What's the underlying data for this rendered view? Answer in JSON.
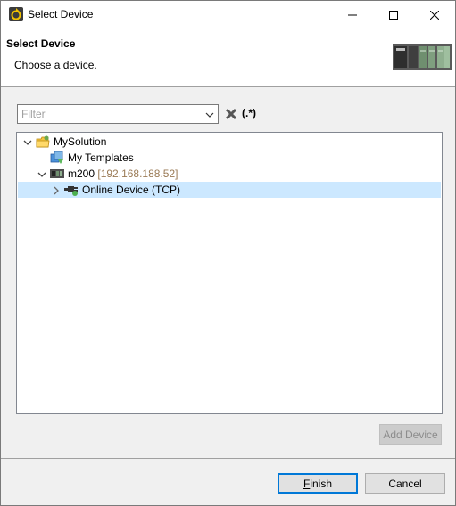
{
  "window": {
    "title": "Select Device"
  },
  "header": {
    "title": "Select Device",
    "description": "Choose a device."
  },
  "filter": {
    "placeholder": "Filter",
    "value": "",
    "regex_label": "(.*)"
  },
  "tree": {
    "nodes": [
      {
        "label": "MySolution",
        "icon": "solution-folder-icon",
        "expanded": true,
        "level": 0
      },
      {
        "label": "My Templates",
        "icon": "templates-icon",
        "level": 1
      },
      {
        "label": "m200",
        "ip": "[192.168.188.52]",
        "icon": "plc-icon",
        "expanded": true,
        "level": 1
      },
      {
        "label": "Online Device (TCP)",
        "icon": "online-device-icon",
        "expanded": false,
        "selected": true,
        "level": 2
      }
    ]
  },
  "buttons": {
    "add_device": "Add Device",
    "finish": "Finish",
    "cancel": "Cancel"
  },
  "colors": {
    "selection": "#cce8ff",
    "ip_text": "#9a7a55",
    "default_button_border": "#0078d7"
  }
}
